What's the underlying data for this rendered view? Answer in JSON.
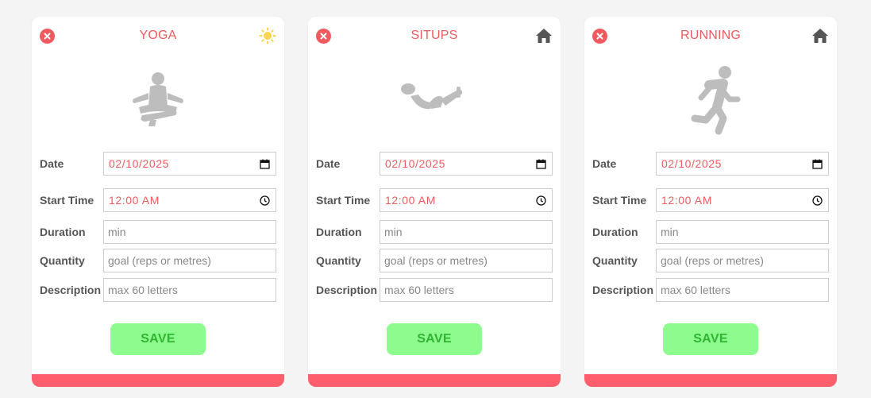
{
  "colors": {
    "accent": "#ef5a5f",
    "bar": "#ff5f6d",
    "save_bg": "#8dfb8d",
    "save_text": "#2fb52f",
    "hero_icon": "#bdbdbd"
  },
  "cards": [
    {
      "title": "YOGA",
      "hero_icon": "yoga-pose-icon",
      "corner_icon": "sun-icon",
      "fields": {
        "date_label": "Date",
        "date_value": "02/10/2025",
        "start_label": "Start Time",
        "start_value": "12:00 AM",
        "duration_label": "Duration",
        "duration_placeholder": "min",
        "quantity_label": "Quantity",
        "quantity_placeholder": "goal (reps or metres)",
        "description_label": "Description",
        "description_placeholder": "max 60 letters"
      },
      "save_label": "SAVE"
    },
    {
      "title": "SITUPS",
      "hero_icon": "situps-icon",
      "corner_icon": "home-icon",
      "fields": {
        "date_label": "Date",
        "date_value": "02/10/2025",
        "start_label": "Start Time",
        "start_value": "12:00 AM",
        "duration_label": "Duration",
        "duration_placeholder": "min",
        "quantity_label": "Quantity",
        "quantity_placeholder": "goal (reps or metres)",
        "description_label": "Description",
        "description_placeholder": "max 60 letters"
      },
      "save_label": "SAVE"
    },
    {
      "title": "RUNNING",
      "hero_icon": "running-icon",
      "corner_icon": "home-icon",
      "fields": {
        "date_label": "Date",
        "date_value": "02/10/2025",
        "start_label": "Start Time",
        "start_value": "12:00 AM",
        "duration_label": "Duration",
        "duration_placeholder": "min",
        "quantity_label": "Quantity",
        "quantity_placeholder": "goal (reps or metres)",
        "description_label": "Description",
        "description_placeholder": "max 60 letters"
      },
      "save_label": "SAVE"
    }
  ]
}
